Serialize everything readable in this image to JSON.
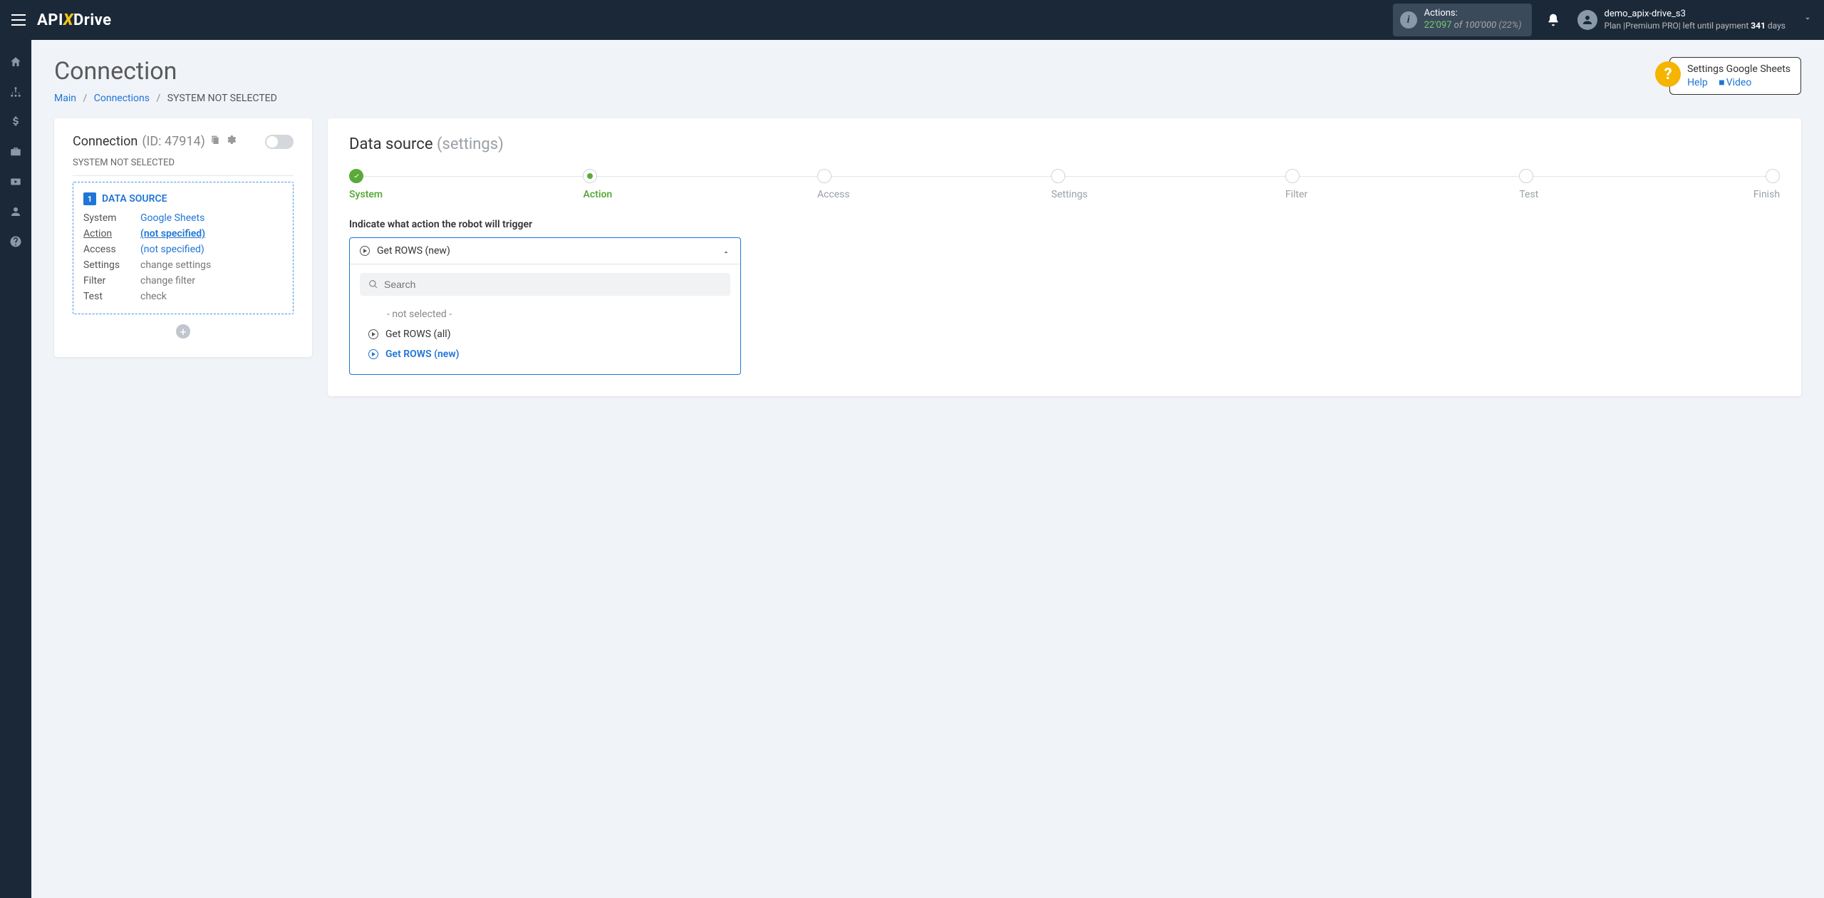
{
  "brand": {
    "pre": "API",
    "mid": "X",
    "post": "Drive"
  },
  "header": {
    "actions_label": "Actions:",
    "actions_used": "22'097",
    "actions_of": "of",
    "actions_total": "100'000",
    "actions_pct": "(22%)",
    "user_name": "demo_apix-drive_s3",
    "plan_prefix": "Plan |",
    "plan_name": "Premium PRO",
    "plan_mid": "| left until payment ",
    "plan_days": "341",
    "plan_suffix": " days"
  },
  "page": {
    "title": "Connection",
    "breadcrumb": {
      "main": "Main",
      "connections": "Connections",
      "current": "SYSTEM NOT SELECTED"
    }
  },
  "help": {
    "title": "Settings Google Sheets",
    "help_label": "Help",
    "video_label": "Video"
  },
  "connection_card": {
    "title": "Connection",
    "id_label": "(ID: 47914)",
    "subtitle": "SYSTEM NOT SELECTED",
    "ds_heading": "DATA SOURCE",
    "rows": {
      "system_k": "System",
      "system_v": "Google Sheets",
      "action_k": "Action",
      "action_v": "(not specified)",
      "access_k": "Access",
      "access_v": "(not specified)",
      "settings_k": "Settings",
      "settings_v": "change settings",
      "filter_k": "Filter",
      "filter_v": "change filter",
      "test_k": "Test",
      "test_v": "check"
    }
  },
  "right": {
    "title": "Data source",
    "title_sub": "(settings)",
    "steps": [
      "System",
      "Action",
      "Access",
      "Settings",
      "Filter",
      "Test",
      "Finish"
    ],
    "field_label": "Indicate what action the robot will trigger",
    "selected": "Get ROWS (new)",
    "search_placeholder": "Search",
    "options": {
      "placeholder": "- not selected -",
      "opt1": "Get ROWS (all)",
      "opt2": "Get ROWS (new)"
    }
  }
}
